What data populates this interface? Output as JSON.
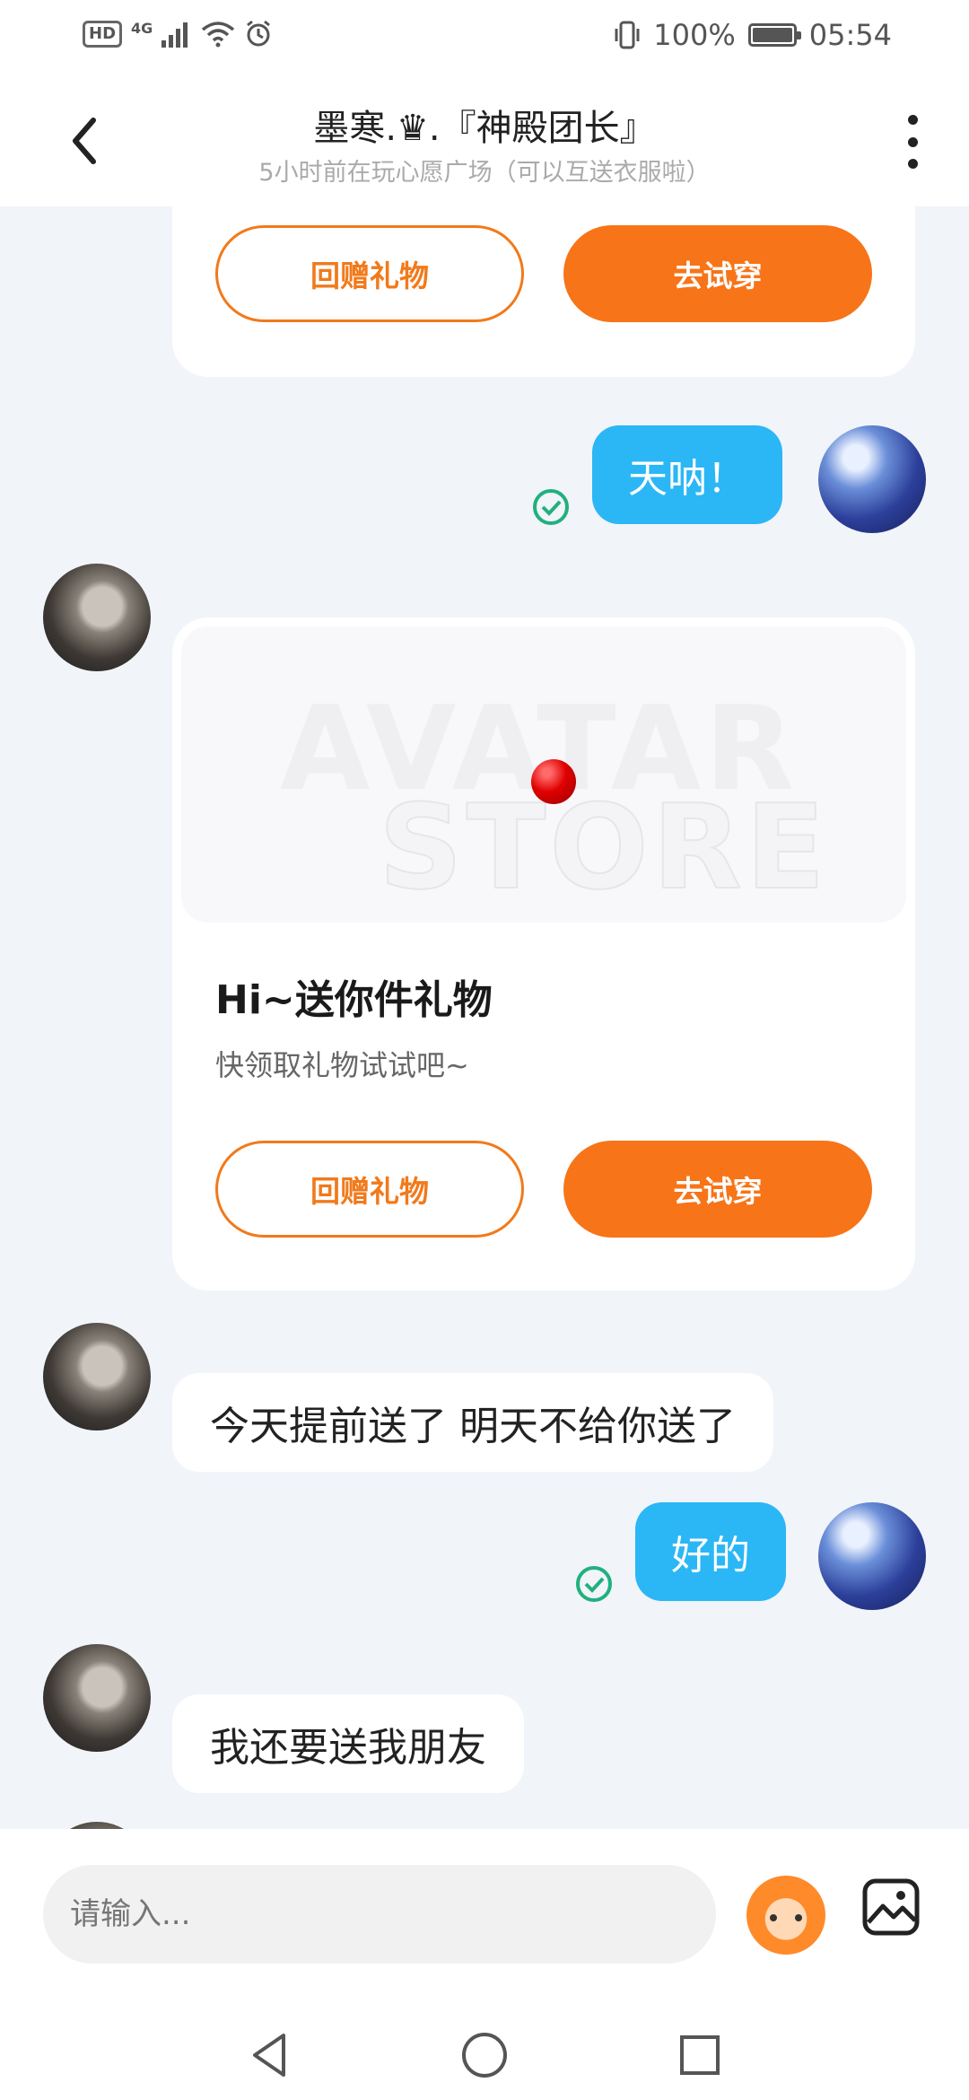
{
  "status_bar": {
    "hd": "HD",
    "network": "4G",
    "battery": "100%",
    "time": "05:54"
  },
  "header": {
    "title": "墨寒.♛.『神殿团长』",
    "subtitle": "5小时前在玩心愿广场（可以互送衣服啦）"
  },
  "messages": {
    "card1": {
      "return_gift": "回赠礼物",
      "try_on": "去试穿"
    },
    "mine1": "天呐！",
    "gift_card": {
      "watermark_top": "AVATAR",
      "watermark_bottom": "STORE",
      "title": "Hi~送你件礼物",
      "desc": "快领取礼物试试吧~",
      "return_gift": "回赠礼物",
      "try_on": "去试穿"
    },
    "theirs1": "今天提前送了 明天不给你送了",
    "mine2": "好的",
    "theirs2": "我还要送我朋友"
  },
  "input": {
    "placeholder": "请输入..."
  },
  "colors": {
    "accent": "#f77418",
    "bubble_mine": "#2bb7f5",
    "check": "#22b07d"
  }
}
